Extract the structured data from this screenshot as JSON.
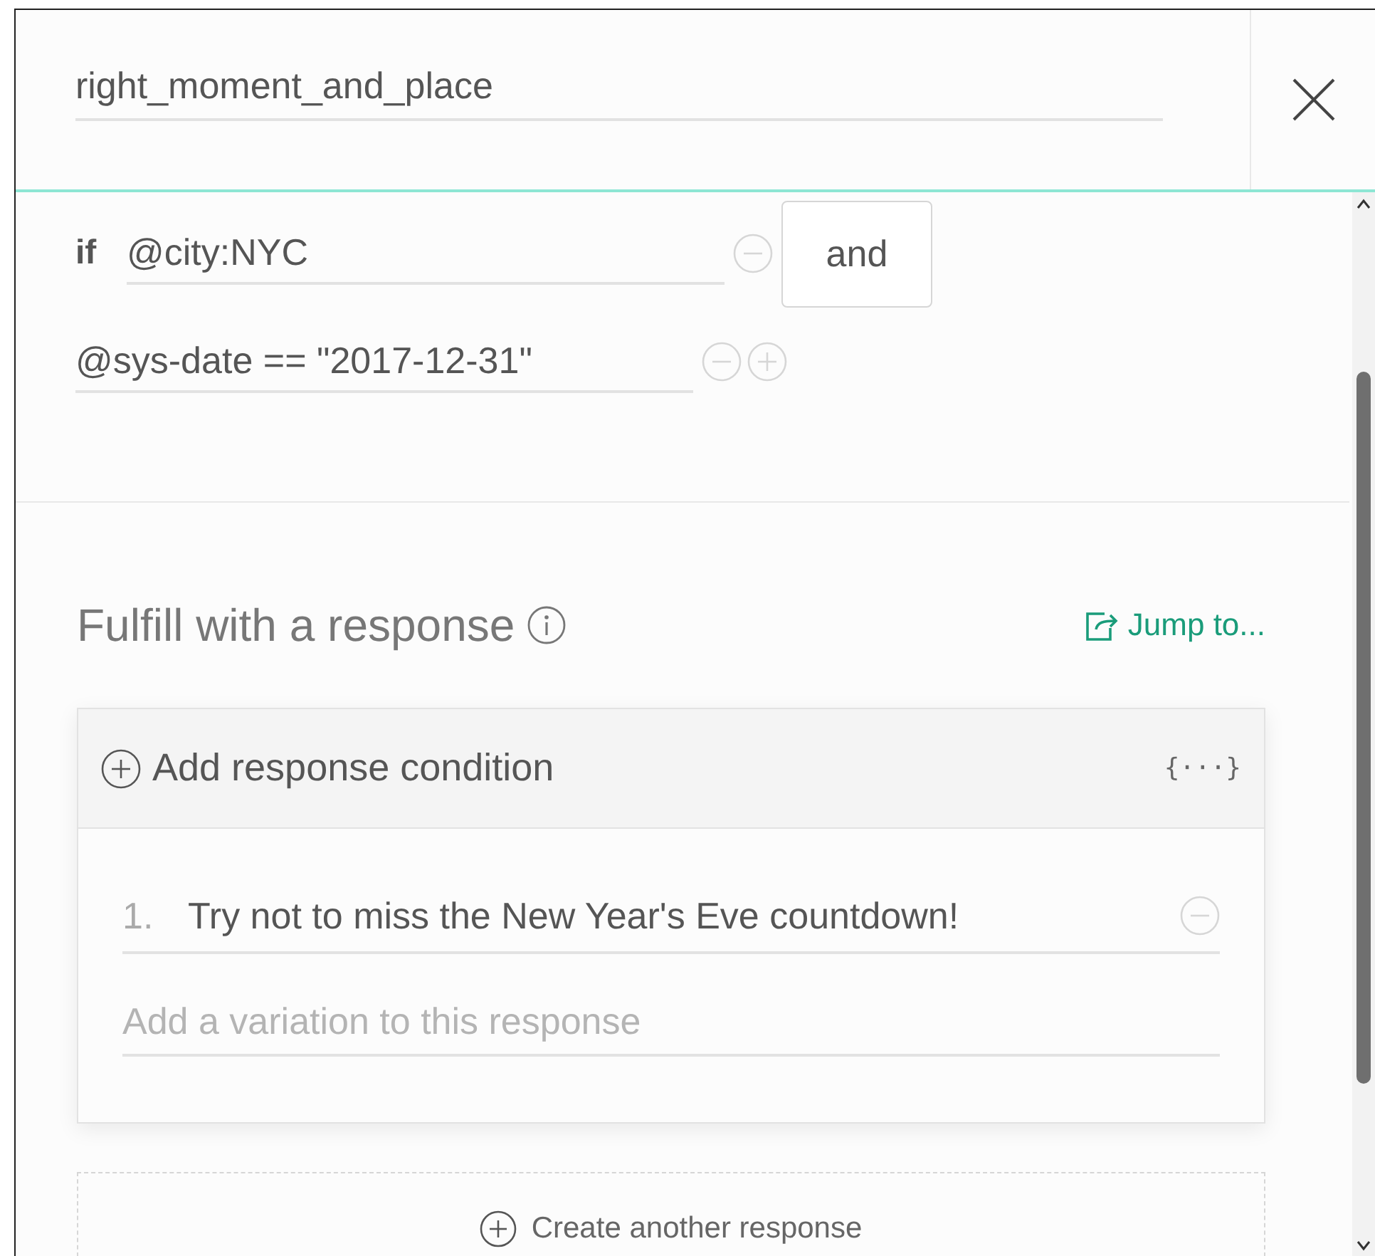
{
  "header": {
    "name_value": "right_moment_and_place"
  },
  "conditions": [
    {
      "prefix": "if",
      "value": "@city:NYC",
      "operator": "and",
      "can_add": false
    },
    {
      "value": "@sys-date == \"2017-12-31\"",
      "can_add": true
    }
  ],
  "response_section": {
    "title": "Fulfill with a response",
    "jump_link": "Jump to...",
    "add_condition": "Add response condition",
    "code_toggle": "{···}",
    "responses": [
      {
        "number": "1.",
        "text": "Try not to miss the New Year's Eve countdown!"
      }
    ],
    "variation_placeholder": "Add a variation to this response",
    "create_button": "Create another response"
  }
}
